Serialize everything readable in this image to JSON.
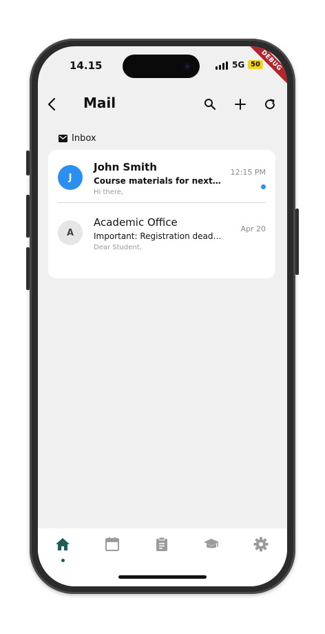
{
  "status_bar": {
    "time": "14.15",
    "network": "5G",
    "battery": "50",
    "debug_banner": "DEBUG"
  },
  "appbar": {
    "title": "Mail",
    "back_icon": "chevron-left-icon",
    "search_icon": "search-icon",
    "compose_icon": "plus-icon",
    "refresh_icon": "refresh-icon"
  },
  "section": {
    "label": "Inbox",
    "icon": "mail-icon"
  },
  "emails": [
    {
      "avatar_letter": "J",
      "avatar_bg": "#2b8ff0",
      "avatar_fg": "#ffffff",
      "sender": "John Smith",
      "subject": "Course materials for next…",
      "preview": "Hi there,",
      "date": "12:15 PM",
      "unread": true
    },
    {
      "avatar_letter": "A",
      "avatar_bg": "#e6e6e6",
      "avatar_fg": "#444444",
      "sender": "Academic Office",
      "subject": "Important: Registration deadli…",
      "preview": "Dear Student,",
      "date": "Apr 20",
      "unread": false
    }
  ],
  "bottom_nav": {
    "items": [
      {
        "icon": "home-icon",
        "active": true
      },
      {
        "icon": "calendar-icon",
        "active": false
      },
      {
        "icon": "clipboard-icon",
        "active": false
      },
      {
        "icon": "graduation-cap-icon",
        "active": false
      },
      {
        "icon": "gear-icon",
        "active": false
      }
    ],
    "active_color": "#1d5d5a",
    "inactive_color": "#9b9b9b"
  }
}
